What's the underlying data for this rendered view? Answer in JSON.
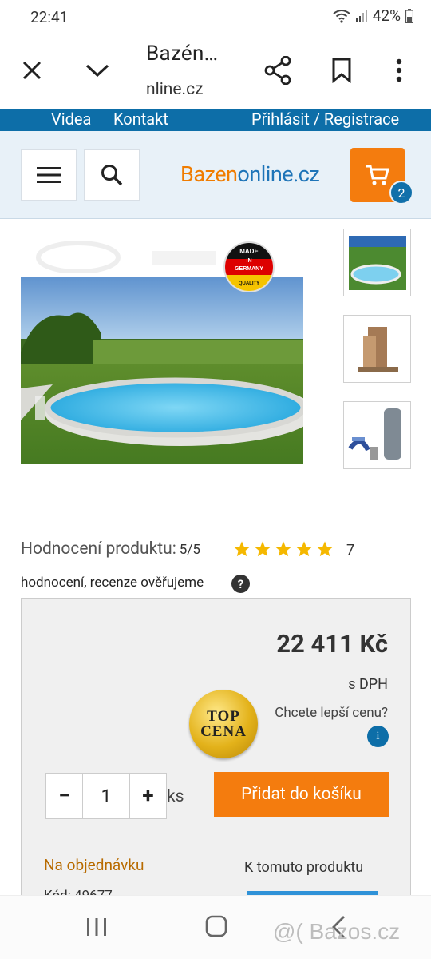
{
  "status": {
    "time": "22:41",
    "battery": "42%"
  },
  "browser": {
    "title": "Bazén…",
    "url": "nline.cz"
  },
  "topnav": {
    "videa": "Videa",
    "kontakt": "Kontakt",
    "login": "Přihlásit / Registrace"
  },
  "header": {
    "logo_part1": "Bazen",
    "logo_part2": "online.cz",
    "cart_count": "2"
  },
  "badge": {
    "line1": "MADE",
    "line2": "IN",
    "line3": "GERMANY",
    "line4": "QUALITY"
  },
  "rating": {
    "label": "Hodnocení produktu:",
    "score": "5/5",
    "stars": 5,
    "count": "7",
    "review_note": "hodnocení, recenze ověřujeme",
    "help": "?"
  },
  "price": {
    "amount": "22 411 Kč",
    "vat": "s DPH",
    "top_line1": "TOP",
    "top_line2": "CENA",
    "better_price": "Chcete lepší cenu?",
    "info": "i"
  },
  "cart_form": {
    "minus": "−",
    "quantity": "1",
    "plus": "+",
    "unit": "ks",
    "add_button": "Přidat do košíku"
  },
  "availability": {
    "order": "Na objednávku",
    "related": "K tomuto produktu",
    "code": "Kód: 49677"
  },
  "watermark": "@( Bazos.cz",
  "colors": {
    "accent_orange": "#f47c0e",
    "brand_blue": "#0d6ea8"
  }
}
